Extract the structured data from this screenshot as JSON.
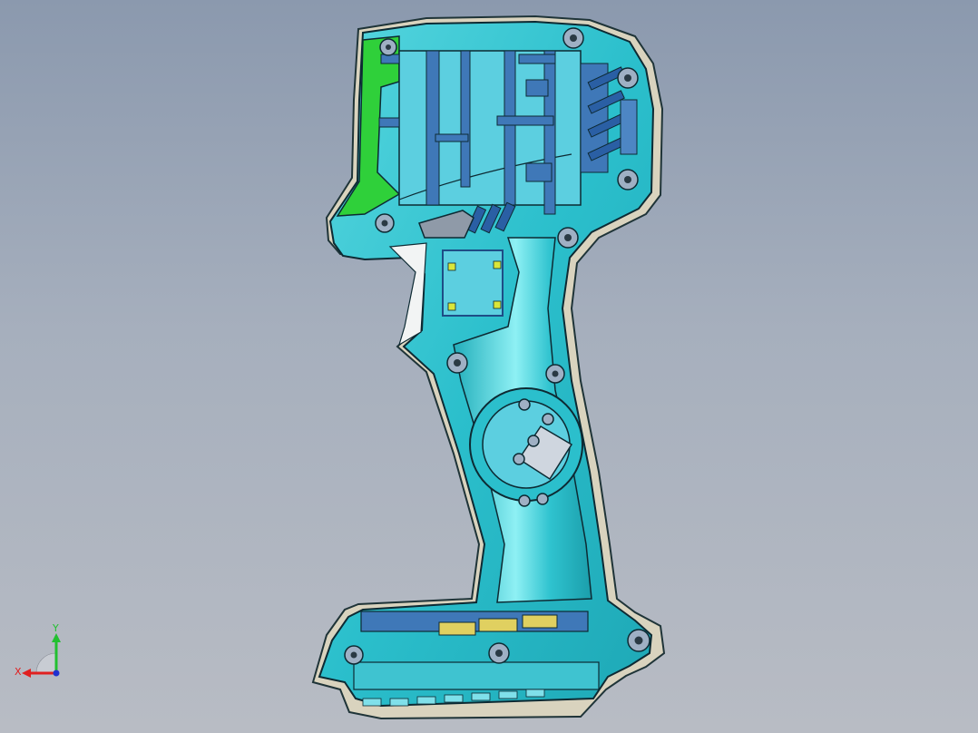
{
  "viewport": {
    "background_top": "#8b99ae",
    "background_bottom": "#b8bcc4"
  },
  "model": {
    "shell_color": "#2ec4d0",
    "shell_highlight": "#7be6ee",
    "outline_color": "#0d2a33",
    "rib_color": "#3f78b8",
    "flange_color": "#d9d3be",
    "accent_green": "#2fd03a",
    "accent_yellow": "#d9e63a"
  },
  "triad": {
    "x_label": "X",
    "y_label": "Y",
    "x_color": "#e02020",
    "y_color": "#22c030",
    "z_color": "#2030d0"
  }
}
